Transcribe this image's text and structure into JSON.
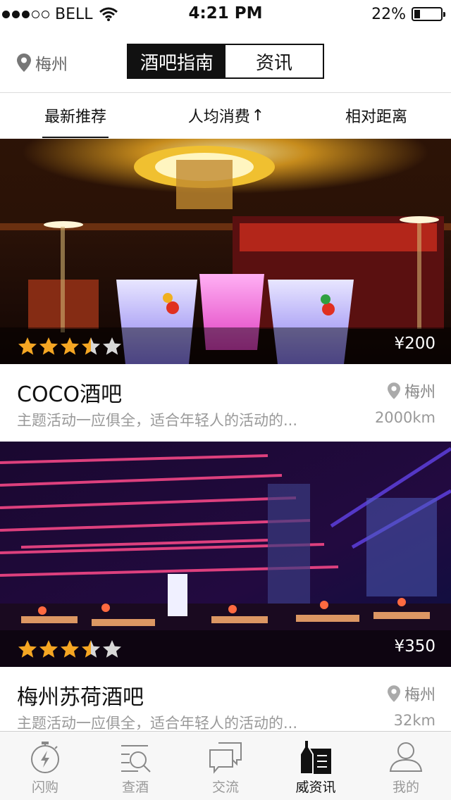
{
  "status_bar": {
    "carrier": "BELL",
    "time": "4:21 PM",
    "battery": "22%",
    "battery_level": 0.22,
    "signal_bars": 2
  },
  "nav": {
    "city": "梅州",
    "segments": [
      {
        "label": "酒吧指南",
        "active": true
      },
      {
        "label": "资讯",
        "active": false
      }
    ]
  },
  "filters": [
    {
      "label": "最新推荐",
      "active": true
    },
    {
      "label": "人均消费",
      "arrow": "↑",
      "active": false
    },
    {
      "label": "相对距离",
      "active": false
    }
  ],
  "bars": [
    {
      "name": "COCO酒吧",
      "rating": 3.5,
      "price": "¥200",
      "location": "梅州",
      "description": "主题活动一应俱全，适合年轻人的活动的...",
      "distance": "2000km"
    },
    {
      "name": "梅州苏荷酒吧",
      "rating": 3.5,
      "price": "¥350",
      "location": "梅州",
      "description": "主题活动一应俱全，适合年轻人的活动的...",
      "distance": "32km"
    }
  ],
  "tabbar": {
    "items": [
      {
        "label": "闪购",
        "icon": "stopwatch-bolt-icon",
        "active": false
      },
      {
        "label": "查酒",
        "icon": "search-list-icon",
        "active": false
      },
      {
        "label": "交流",
        "icon": "chat-bubbles-icon",
        "active": false
      },
      {
        "label": "威资讯",
        "icon": "bottle-news-icon",
        "active": true
      },
      {
        "label": "我的",
        "icon": "person-icon",
        "active": false
      }
    ]
  },
  "colors": {
    "star_filled": "#f5a623",
    "star_empty": "#d8d8d8",
    "active_text": "#111111",
    "inactive_text": "#999999"
  }
}
